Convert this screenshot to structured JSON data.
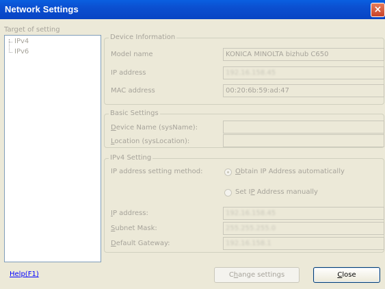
{
  "window": {
    "title": "Network Settings",
    "close_glyph": "×"
  },
  "target": {
    "label": "Target of setting",
    "items": [
      "IPv4",
      "IPv6"
    ]
  },
  "device_info": {
    "title": "Device Information",
    "model_label": "Model name",
    "model_value": "KONICA MINOLTA bizhub C650",
    "ip_label": "IP address",
    "ip_value": "192.16.158.45",
    "mac_label": "MAC address",
    "mac_value": "00:20:6b:59:ad:47"
  },
  "basic_settings": {
    "title": "Basic Settings",
    "device_name_label": "Device Name (sysName):",
    "device_name_value": "",
    "location_label": "Location (sysLocation):",
    "location_value": ""
  },
  "ipv4": {
    "title": "IPv4 Setting",
    "method_label": "IP address setting method:",
    "obtain_label": "Obtain IP Address automatically",
    "manual_label": "Set IP Address manually",
    "ip_label": "IP address:",
    "ip_value": "192.16.158.45",
    "subnet_label": "Subnet Mask:",
    "subnet_value": "255.255.255.0",
    "gateway_label": "Default Gateway:",
    "gateway_value": "192.16.158.1"
  },
  "footer": {
    "help_label": "Help(F1)",
    "change_label": "Change settings",
    "close_label": "Close"
  }
}
